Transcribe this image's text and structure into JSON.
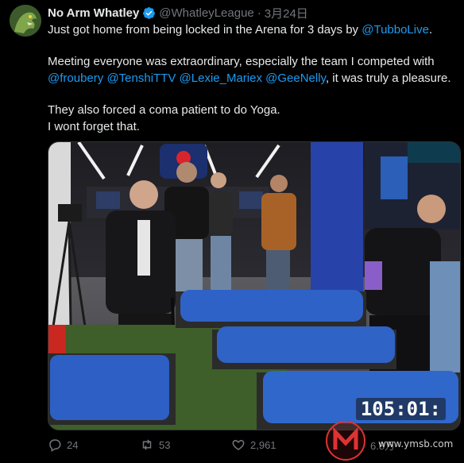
{
  "author": {
    "name": "No Arm Whatley",
    "handle": "@WhatleyLeague",
    "separator": "·",
    "date": "3月24日"
  },
  "tweet": {
    "line1_text": "Just got home from being locked in the Arena for 3 days by ",
    "line1_mention": "@TubboLive",
    "line1_end": ".",
    "para2_text": "Meeting everyone was extraordinary, especially the team I competed with ",
    "para2_mentions": [
      "@froubery",
      "@TenshiTTV",
      "@Lexie_Mariex",
      "@GeeNelly"
    ],
    "para2_end": ", it was truly a pleasure.",
    "para3_line1": "They also forced a coma patient to do Yoga.",
    "para3_line2": "I wont forget that."
  },
  "media": {
    "timer": "105:01:"
  },
  "actions": {
    "replies": "24",
    "reposts": "53",
    "likes": "2,961",
    "views": "6.8万"
  },
  "watermark": {
    "text": "www.ymsb.com"
  },
  "colors": {
    "background": "#000000",
    "text": "#e7e9ea",
    "secondary": "#71767b",
    "link": "#1d9bf0"
  }
}
